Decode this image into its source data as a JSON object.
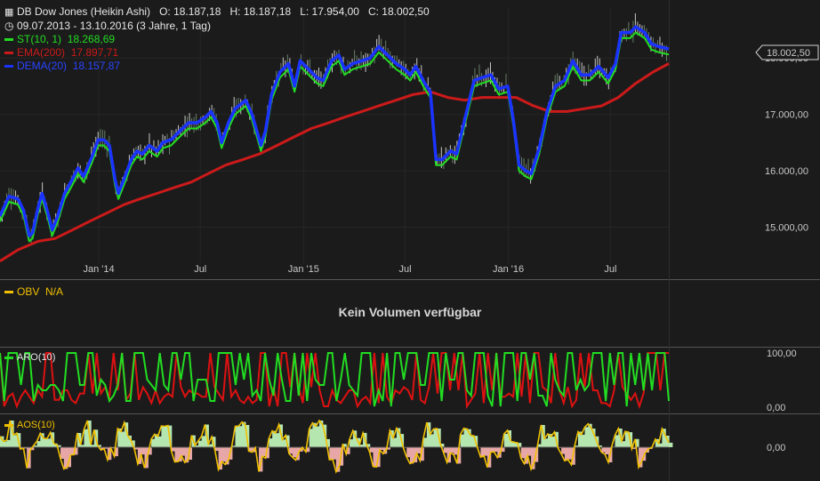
{
  "header": {
    "title": "DB Dow Jones (Heikin Ashi)",
    "ohlc": {
      "o": "O: 18.187,18",
      "h": "H: 18.187,18",
      "l": "L: 17.954,00",
      "c": "C: 18.002,50"
    },
    "range": "09.07.2013 - 13.10.2016 (3 Jahre, 1 Tag)",
    "legend": [
      {
        "key": "st",
        "name": "ST(10, 1)",
        "value": "18.268,69",
        "color": "#22dd22"
      },
      {
        "key": "ema",
        "name": "EMA(200)",
        "value": "17.897,71",
        "color": "#cc1a1a"
      },
      {
        "key": "dema",
        "name": "DEMA(20)",
        "value": "18.157,87",
        "color": "#1a33ff"
      }
    ]
  },
  "price_marker": "18.002,50",
  "obv": {
    "legend_name": "OBV",
    "legend_value": "N/A",
    "message": "Kein Volumen verfügbar",
    "color": "#f0c000"
  },
  "aro": {
    "legend": "ARO(10)",
    "up_color": "#22dd22",
    "down_color": "#dd1111",
    "ticks": [
      "100,00",
      "0,00"
    ]
  },
  "aos": {
    "legend": "AOS(10)",
    "ticks": [
      "0,00"
    ],
    "pos_color": "#b6e6b0",
    "neg_color": "#e8a7a7",
    "line_color": "#f0c000"
  },
  "chart_data": {
    "type": "line",
    "title": "DB Dow Jones (Heikin Ashi)",
    "x_ticks": [
      "Jan '14",
      "Jul",
      "Jan '15",
      "Jul",
      "Jan '16",
      "Jul"
    ],
    "y_ticks": [
      "18.000,00",
      "17.000,00",
      "16.000,00",
      "15.000,00"
    ],
    "ylim": [
      14300,
      18900
    ],
    "series": [
      {
        "name": "DEMA(20)",
        "color": "#1a33ff",
        "points": [
          [
            "2013-07-09",
            15200
          ],
          [
            "2013-07-25",
            15550
          ],
          [
            "2013-08-10",
            15500
          ],
          [
            "2013-08-20",
            15300
          ],
          [
            "2013-08-30",
            14850
          ],
          [
            "2013-09-05",
            14900
          ],
          [
            "2013-09-15",
            15350
          ],
          [
            "2013-09-22",
            15600
          ],
          [
            "2013-10-01",
            15300
          ],
          [
            "2013-10-10",
            14950
          ],
          [
            "2013-10-20",
            15200
          ],
          [
            "2013-11-01",
            15600
          ],
          [
            "2013-11-15",
            15850
          ],
          [
            "2013-11-25",
            16050
          ],
          [
            "2013-12-05",
            15900
          ],
          [
            "2013-12-20",
            16250
          ],
          [
            "2013-12-31",
            16550
          ],
          [
            "2014-01-10",
            16550
          ],
          [
            "2014-01-20",
            16450
          ],
          [
            "2014-01-30",
            15850
          ],
          [
            "2014-02-05",
            15600
          ],
          [
            "2014-02-15",
            15850
          ],
          [
            "2014-02-28",
            16200
          ],
          [
            "2014-03-10",
            16350
          ],
          [
            "2014-03-20",
            16300
          ],
          [
            "2014-04-01",
            16450
          ],
          [
            "2014-04-15",
            16350
          ],
          [
            "2014-04-25",
            16500
          ],
          [
            "2014-05-10",
            16550
          ],
          [
            "2014-05-25",
            16700
          ],
          [
            "2014-06-10",
            16850
          ],
          [
            "2014-06-25",
            16850
          ],
          [
            "2014-07-10",
            16950
          ],
          [
            "2014-07-20",
            17050
          ],
          [
            "2014-07-31",
            16850
          ],
          [
            "2014-08-08",
            16500
          ],
          [
            "2014-08-20",
            16850
          ],
          [
            "2014-09-01",
            17100
          ],
          [
            "2014-09-20",
            17250
          ],
          [
            "2014-10-01",
            17000
          ],
          [
            "2014-10-10",
            16700
          ],
          [
            "2014-10-17",
            16450
          ],
          [
            "2014-10-25",
            16700
          ],
          [
            "2014-11-05",
            17350
          ],
          [
            "2014-11-20",
            17750
          ],
          [
            "2014-12-05",
            17900
          ],
          [
            "2014-12-16",
            17500
          ],
          [
            "2014-12-26",
            17950
          ],
          [
            "2015-01-10",
            17800
          ],
          [
            "2015-01-25",
            17650
          ],
          [
            "2015-02-05",
            17600
          ],
          [
            "2015-02-20",
            17950
          ],
          [
            "2015-03-05",
            18050
          ],
          [
            "2015-03-15",
            17800
          ],
          [
            "2015-03-30",
            17900
          ],
          [
            "2015-04-15",
            17950
          ],
          [
            "2015-04-30",
            18000
          ],
          [
            "2015-05-15",
            18200
          ],
          [
            "2015-05-31",
            18050
          ],
          [
            "2015-06-15",
            17900
          ],
          [
            "2015-06-30",
            17800
          ],
          [
            "2015-07-10",
            17700
          ],
          [
            "2015-07-20",
            17850
          ],
          [
            "2015-08-05",
            17550
          ],
          [
            "2015-08-15",
            17400
          ],
          [
            "2015-08-25",
            16200
          ],
          [
            "2015-09-05",
            16200
          ],
          [
            "2015-09-20",
            16350
          ],
          [
            "2015-10-01",
            16300
          ],
          [
            "2015-10-15",
            16900
          ],
          [
            "2015-11-01",
            17600
          ],
          [
            "2015-11-15",
            17650
          ],
          [
            "2015-12-01",
            17700
          ],
          [
            "2015-12-15",
            17450
          ],
          [
            "2015-12-31",
            17500
          ],
          [
            "2016-01-10",
            16900
          ],
          [
            "2016-01-20",
            16100
          ],
          [
            "2016-02-01",
            16000
          ],
          [
            "2016-02-11",
            15950
          ],
          [
            "2016-02-25",
            16400
          ],
          [
            "2016-03-10",
            17050
          ],
          [
            "2016-03-25",
            17500
          ],
          [
            "2016-04-10",
            17600
          ],
          [
            "2016-04-25",
            17950
          ],
          [
            "2016-05-10",
            17700
          ],
          [
            "2016-05-25",
            17700
          ],
          [
            "2016-06-10",
            17850
          ],
          [
            "2016-06-27",
            17650
          ],
          [
            "2016-07-10",
            17900
          ],
          [
            "2016-07-20",
            18450
          ],
          [
            "2016-08-05",
            18450
          ],
          [
            "2016-08-15",
            18550
          ],
          [
            "2016-08-31",
            18450
          ],
          [
            "2016-09-12",
            18250
          ],
          [
            "2016-09-25",
            18200
          ],
          [
            "2016-10-13",
            18160
          ]
        ]
      },
      {
        "name": "ST(10, 1)",
        "color": "#22dd22",
        "points": [
          [
            "2013-07-09",
            15100
          ],
          [
            "2013-07-25",
            15450
          ],
          [
            "2013-08-10",
            15400
          ],
          [
            "2013-08-20",
            15200
          ],
          [
            "2013-08-30",
            14750
          ],
          [
            "2013-09-05",
            14800
          ],
          [
            "2013-09-15",
            15250
          ],
          [
            "2013-09-22",
            15500
          ],
          [
            "2013-10-01",
            15200
          ],
          [
            "2013-10-10",
            14850
          ],
          [
            "2013-10-20",
            15100
          ],
          [
            "2013-11-01",
            15500
          ],
          [
            "2013-11-15",
            15750
          ],
          [
            "2013-11-25",
            15950
          ],
          [
            "2013-12-05",
            15800
          ],
          [
            "2013-12-20",
            16150
          ],
          [
            "2013-12-31",
            16450
          ],
          [
            "2014-01-10",
            16450
          ],
          [
            "2014-01-20",
            16350
          ],
          [
            "2014-01-30",
            15750
          ],
          [
            "2014-02-05",
            15500
          ],
          [
            "2014-02-15",
            15750
          ],
          [
            "2014-02-28",
            16100
          ],
          [
            "2014-03-10",
            16250
          ],
          [
            "2014-03-20",
            16200
          ],
          [
            "2014-04-01",
            16350
          ],
          [
            "2014-04-15",
            16250
          ],
          [
            "2014-04-25",
            16400
          ],
          [
            "2014-05-10",
            16450
          ],
          [
            "2014-05-25",
            16600
          ],
          [
            "2014-06-10",
            16750
          ],
          [
            "2014-06-25",
            16750
          ],
          [
            "2014-07-10",
            16850
          ],
          [
            "2014-07-20",
            16950
          ],
          [
            "2014-07-31",
            16750
          ],
          [
            "2014-08-08",
            16400
          ],
          [
            "2014-08-20",
            16750
          ],
          [
            "2014-09-01",
            17000
          ],
          [
            "2014-09-20",
            17150
          ],
          [
            "2014-10-01",
            16900
          ],
          [
            "2014-10-10",
            16600
          ],
          [
            "2014-10-17",
            16350
          ],
          [
            "2014-10-25",
            16600
          ],
          [
            "2014-11-05",
            17250
          ],
          [
            "2014-11-20",
            17650
          ],
          [
            "2014-12-05",
            17800
          ],
          [
            "2014-12-16",
            17400
          ],
          [
            "2014-12-26",
            17850
          ],
          [
            "2015-01-10",
            17700
          ],
          [
            "2015-01-25",
            17550
          ],
          [
            "2015-02-05",
            17500
          ],
          [
            "2015-02-20",
            17850
          ],
          [
            "2015-03-05",
            17950
          ],
          [
            "2015-03-15",
            17700
          ],
          [
            "2015-03-30",
            17800
          ],
          [
            "2015-04-15",
            17850
          ],
          [
            "2015-04-30",
            17900
          ],
          [
            "2015-05-15",
            18100
          ],
          [
            "2015-05-31",
            17950
          ],
          [
            "2015-06-15",
            17800
          ],
          [
            "2015-06-30",
            17700
          ],
          [
            "2015-07-10",
            17600
          ],
          [
            "2015-07-20",
            17750
          ],
          [
            "2015-08-05",
            17450
          ],
          [
            "2015-08-15",
            17300
          ],
          [
            "2015-08-25",
            16100
          ],
          [
            "2015-09-05",
            16100
          ],
          [
            "2015-09-20",
            16250
          ],
          [
            "2015-10-01",
            16200
          ],
          [
            "2015-10-15",
            16800
          ],
          [
            "2015-11-01",
            17500
          ],
          [
            "2015-11-15",
            17550
          ],
          [
            "2015-12-01",
            17600
          ],
          [
            "2015-12-15",
            17350
          ],
          [
            "2015-12-31",
            17400
          ],
          [
            "2016-01-10",
            16800
          ],
          [
            "2016-01-20",
            16000
          ],
          [
            "2016-02-01",
            15900
          ],
          [
            "2016-02-11",
            15850
          ],
          [
            "2016-02-25",
            16300
          ],
          [
            "2016-03-10",
            16950
          ],
          [
            "2016-03-25",
            17400
          ],
          [
            "2016-04-10",
            17500
          ],
          [
            "2016-04-25",
            17850
          ],
          [
            "2016-05-10",
            17600
          ],
          [
            "2016-05-25",
            17600
          ],
          [
            "2016-06-10",
            17750
          ],
          [
            "2016-06-27",
            17550
          ],
          [
            "2016-07-10",
            17800
          ],
          [
            "2016-07-20",
            18350
          ],
          [
            "2016-08-05",
            18350
          ],
          [
            "2016-08-15",
            18450
          ],
          [
            "2016-08-31",
            18350
          ],
          [
            "2016-09-12",
            18150
          ],
          [
            "2016-09-25",
            18100
          ],
          [
            "2016-10-13",
            18060
          ]
        ]
      },
      {
        "name": "EMA(200)",
        "color": "#cc1a1a",
        "points": [
          [
            "2013-07-09",
            14400
          ],
          [
            "2013-08-10",
            14600
          ],
          [
            "2013-09-15",
            14750
          ],
          [
            "2013-10-15",
            14800
          ],
          [
            "2013-11-15",
            14950
          ],
          [
            "2013-12-15",
            15100
          ],
          [
            "2014-01-15",
            15250
          ],
          [
            "2014-02-15",
            15400
          ],
          [
            "2014-03-15",
            15500
          ],
          [
            "2014-04-15",
            15600
          ],
          [
            "2014-05-15",
            15700
          ],
          [
            "2014-06-15",
            15800
          ],
          [
            "2014-07-15",
            15950
          ],
          [
            "2014-08-15",
            16100
          ],
          [
            "2014-09-15",
            16200
          ],
          [
            "2014-10-15",
            16300
          ],
          [
            "2014-11-15",
            16450
          ],
          [
            "2014-12-15",
            16600
          ],
          [
            "2015-01-15",
            16750
          ],
          [
            "2015-02-15",
            16850
          ],
          [
            "2015-03-15",
            16950
          ],
          [
            "2015-04-15",
            17050
          ],
          [
            "2015-05-15",
            17150
          ],
          [
            "2015-06-15",
            17250
          ],
          [
            "2015-07-15",
            17350
          ],
          [
            "2015-08-15",
            17400
          ],
          [
            "2015-09-15",
            17300
          ],
          [
            "2015-10-15",
            17250
          ],
          [
            "2015-11-15",
            17300
          ],
          [
            "2015-12-15",
            17300
          ],
          [
            "2016-01-15",
            17300
          ],
          [
            "2016-02-15",
            17150
          ],
          [
            "2016-03-15",
            17050
          ],
          [
            "2016-04-15",
            17050
          ],
          [
            "2016-05-15",
            17100
          ],
          [
            "2016-06-15",
            17150
          ],
          [
            "2016-07-15",
            17300
          ],
          [
            "2016-08-15",
            17550
          ],
          [
            "2016-09-15",
            17750
          ],
          [
            "2016-10-13",
            17900
          ]
        ]
      }
    ]
  }
}
